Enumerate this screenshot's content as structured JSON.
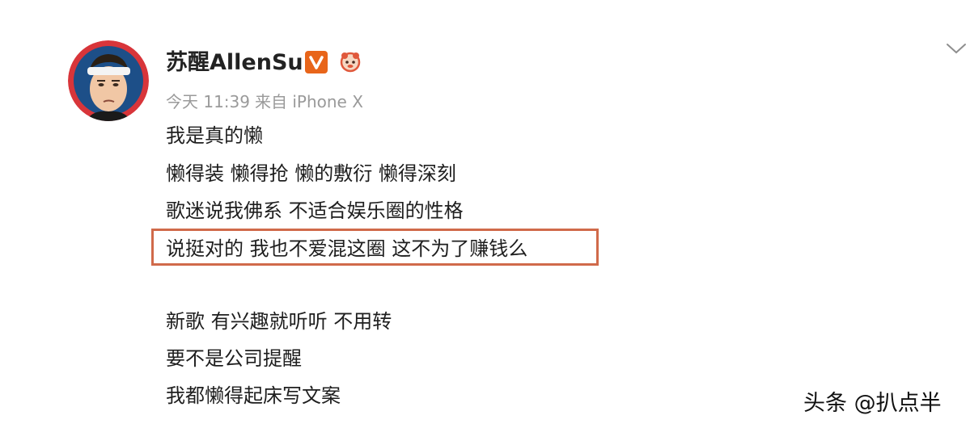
{
  "post": {
    "username": "苏醒AllenSu",
    "timestamp": "今天 11:39",
    "source": "来自 iPhone X",
    "lines": [
      "我是真的懒",
      "懒得装 懒得抢 懒的敷衍 懒得深刻",
      "歌迷说我佛系 不适合娱乐圈的性格",
      "说挺对的 我也不爱混这圈 这不为了赚钱么",
      "新歌 有兴趣就听听 不用转",
      "要不是公司提醒",
      "我都懒得起床写文案"
    ],
    "highlighted_line_index": 3
  },
  "watermark": "头条 @扒点半",
  "colors": {
    "verified_badge": "#e8651a",
    "highlight_border": "#d06a4a",
    "meta_text": "#9a9a9a"
  },
  "icons": {
    "verified": "verified-v-badge-icon",
    "vip": "vip-mascot-icon",
    "menu": "chevron-down-icon"
  }
}
